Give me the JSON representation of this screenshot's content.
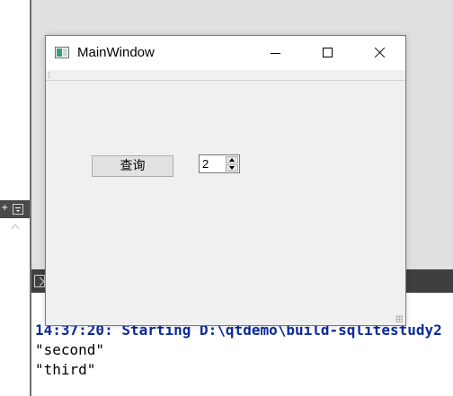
{
  "background": {
    "output_lines": [
      "14:37:20: Starting D:\\qtdemo\\build-sqlitestudy2",
      "\"second\"",
      "\"third\""
    ],
    "colors": {
      "output_header": "#0b2a9c",
      "panel_bar": "#3f3f3f"
    },
    "icons": [
      "plus-icon",
      "dropdown-icon",
      "scroll-up-icon",
      "panel-icon"
    ]
  },
  "window": {
    "title": "MainWindow",
    "icons": [
      "app-icon",
      "minimize-icon",
      "maximize-icon",
      "close-icon"
    ],
    "query_button": {
      "label": "查询"
    },
    "spinbox": {
      "value": "2"
    }
  }
}
